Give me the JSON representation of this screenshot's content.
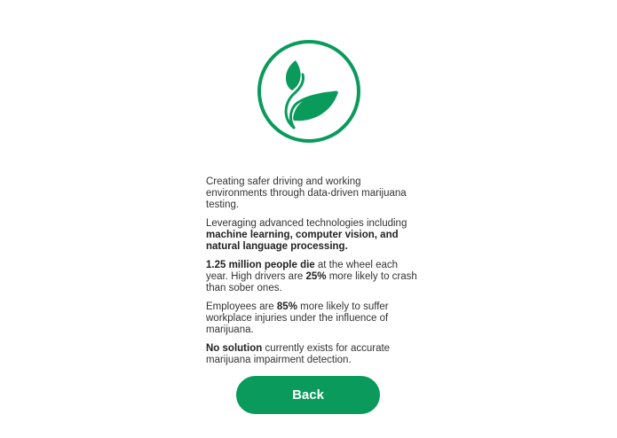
{
  "brand": {
    "logo_icon": "sprout-icon",
    "accent_color": "#0a9a5c"
  },
  "paragraphs": [
    {
      "parts": [
        {
          "text": "Creating safer driving and working environments through data-driven marijuana testing.",
          "bold": false
        }
      ]
    },
    {
      "parts": [
        {
          "text": "Leveraging advanced technologies including ",
          "bold": false
        },
        {
          "text": "machine learning, computer vision, and natural language processing.",
          "bold": true
        }
      ]
    },
    {
      "parts": [
        {
          "text": "1.25 million people die",
          "bold": true
        },
        {
          "text": " at the wheel each year. High drivers are ",
          "bold": false
        },
        {
          "text": "25%",
          "bold": true
        },
        {
          "text": " more likely to crash than sober ones.",
          "bold": false
        }
      ]
    },
    {
      "parts": [
        {
          "text": "Employees are ",
          "bold": false
        },
        {
          "text": "85%",
          "bold": true
        },
        {
          "text": " more likely to suffer workplace injuries under the influence of marijuana.",
          "bold": false
        }
      ]
    },
    {
      "parts": [
        {
          "text": "No solution",
          "bold": true
        },
        {
          "text": " currently exists for accurate marijuana impairment detection.",
          "bold": false
        }
      ]
    }
  ],
  "back_button": {
    "label": "Back"
  }
}
